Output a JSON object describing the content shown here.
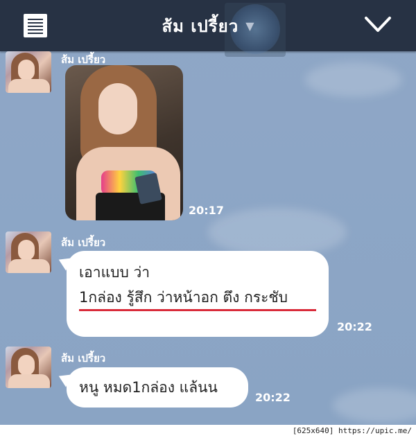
{
  "header": {
    "title": "ส้ม เปรี้ยว",
    "title_caret_icon": "caret-down-icon",
    "menu_icon": "menu-list-icon",
    "collapse_icon": "chevron-down-icon",
    "background_color": "#273244"
  },
  "messages": [
    {
      "sender": "ส้ม เปรี้ยว",
      "kind": "photo",
      "time": "20:17"
    },
    {
      "sender": "ส้ม เปรี้ยว",
      "kind": "text",
      "lines": [
        "เอาแบบ ว่า",
        "1กล่อง รู้สึก ว่าหน้าอก ตึง กระชับ"
      ],
      "underlined_line_index": 1,
      "time": "20:22"
    },
    {
      "sender": "ส้ม เปรี้ยว",
      "kind": "text",
      "lines": [
        "หนู หมด1กล่อง แล้นน"
      ],
      "time": "20:22"
    }
  ],
  "colors": {
    "chat_background": "#8da6c6",
    "bubble": "#ffffff",
    "underline": "#d92b3a"
  },
  "watermark": "[625x640] https://upic.me/"
}
